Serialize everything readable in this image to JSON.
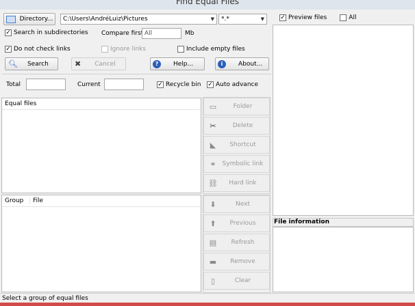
{
  "window": {
    "title": "Find Equal Files"
  },
  "toolbar": {
    "directory_label": "Directory...",
    "path_value": "C:\\Users\\AndréLuiz\\Pictures",
    "mask_value": "*.*",
    "search_label": "Search",
    "cancel_label": "Cancel",
    "help_label": "Help...",
    "about_label": "About..."
  },
  "options": {
    "search_subdirs": "Search in subdirectories",
    "compare_first": "Compare first",
    "compare_value": "All",
    "compare_unit": "Mb",
    "no_links": "Do not check links",
    "ignore_links": "Ignore links",
    "include_empty": "Include empty files"
  },
  "counters": {
    "total_label": "Total",
    "total_value": "",
    "current_label": "Current",
    "current_value": "",
    "recycle_bin": "Recycle bin",
    "auto_advance": "Auto advance"
  },
  "equal_files": {
    "header": "Equal files"
  },
  "group_list": {
    "col_group": "Group",
    "col_file": "File"
  },
  "actions_top": {
    "folder": "Folder",
    "delete": "Delete",
    "shortcut": "Shortcut",
    "symbolic_link": "Symbolic link",
    "hard_link": "Hard link"
  },
  "actions_bottom": {
    "next": "Next",
    "previous": "Previous",
    "refresh": "Refresh",
    "remove": "Remove",
    "clear": "Clear"
  },
  "preview": {
    "preview_files": "Preview files",
    "all": "All",
    "file_info": "File information"
  },
  "status": {
    "text": "Select a group of equal files"
  },
  "colors": {
    "status_accent": "#d24a4a",
    "info_icon": "#2b5fb8",
    "cancel_x": "#444444"
  }
}
